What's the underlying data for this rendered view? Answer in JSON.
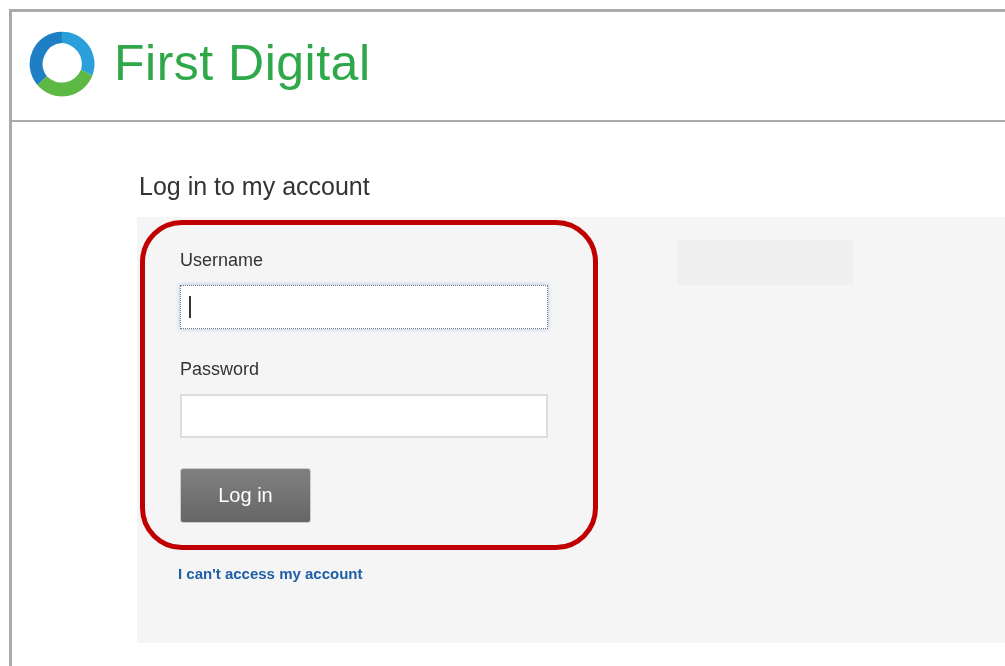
{
  "header": {
    "logo_text": "First Digital"
  },
  "page": {
    "title": "Log in to my account"
  },
  "form": {
    "fields": [
      {
        "label": "Username",
        "focused": true
      },
      {
        "label": "Password",
        "focused": false
      }
    ],
    "submit": "Log in",
    "help_link": "I can't access my account"
  }
}
